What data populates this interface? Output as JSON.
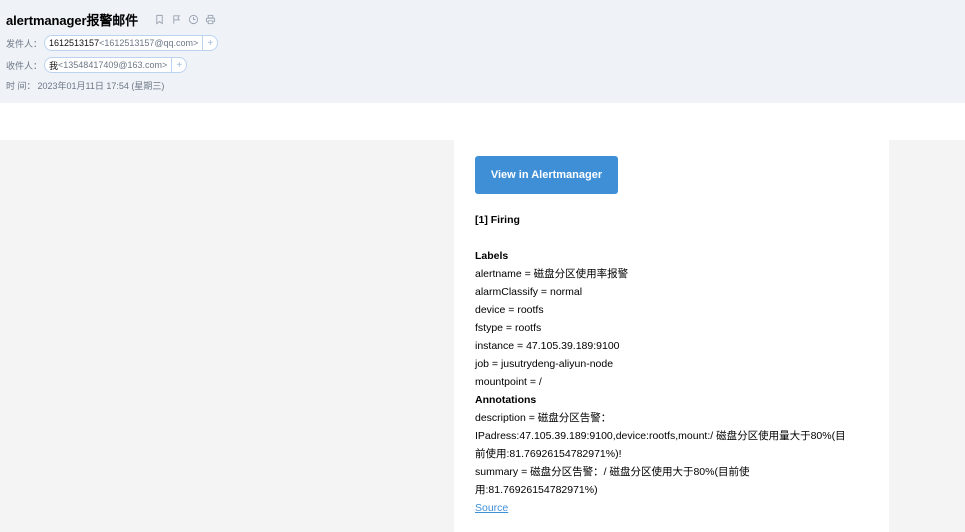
{
  "header": {
    "subject": "alertmanager报警邮件",
    "from": {
      "label": "发件人：",
      "name": "1612513157",
      "email": "<1612513157@qq.com>"
    },
    "to": {
      "label": "收件人：",
      "name": "我",
      "email": "<13548417409@163.com>"
    },
    "time": {
      "label": "时 间：",
      "value": "2023年01月11日 17:54 (星期三)"
    },
    "tools": [
      "bookmark-icon",
      "flag-icon",
      "clock-icon",
      "print-icon"
    ]
  },
  "body": {
    "button_label": "View in Alertmanager",
    "firing": "[1] Firing",
    "labels_heading": "Labels",
    "labels": [
      "alertname = 磁盘分区使用率报警",
      "alarmClassify = normal",
      "device = rootfs",
      "fstype = rootfs",
      "instance = 47.105.39.189:9100",
      "job = jusutrydeng-aliyun-node",
      "mountpoint = /"
    ],
    "annotations_heading": "Annotations",
    "annotations": [
      "description = 磁盘分区告警：",
      "IPadress:47.105.39.189:9100,device:rootfs,mount:/ 磁盘分区使用量大于80%(目",
      "前使用:81.76926154782971%)!",
      "summary = 磁盘分区告警：/ 磁盘分区使用大于80%(目前使",
      "用:81.76926154782971%)"
    ],
    "source_link": "Source"
  },
  "colors": {
    "header_bg": "#eff2f7",
    "button_bg": "#3f8fd7",
    "link": "#3f8fd7",
    "body_bg": "#f4f4f4"
  }
}
